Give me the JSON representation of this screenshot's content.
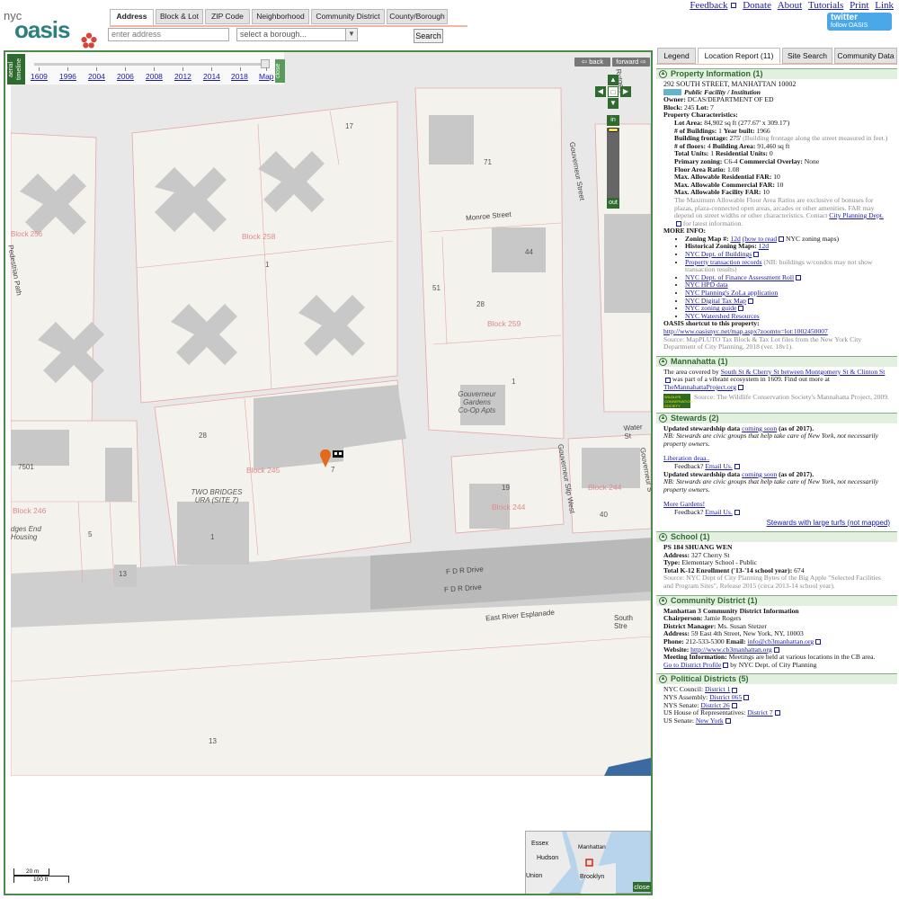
{
  "logo": {
    "top": "nyc",
    "main": "oasis"
  },
  "toplinks": [
    "Feedback",
    "Donate",
    "About",
    "Tutorials",
    "Print",
    "Link"
  ],
  "twitter": {
    "label": "twitter",
    "sub": "follow OASIS"
  },
  "search": {
    "tabs": [
      "Address",
      "Block & Lot",
      "ZIP Code",
      "Neighborhood",
      "Community District",
      "County/Borough"
    ],
    "address_placeholder": "enter address",
    "borough_placeholder": "select a borough...",
    "button": "Search"
  },
  "map": {
    "aerial_label": "aerial timeline",
    "close_label": "close",
    "years": [
      "1609",
      "1996",
      "2004",
      "2006",
      "2008",
      "2012",
      "2014",
      "2018",
      "Map"
    ],
    "back_label": "back",
    "forward_label": "forward",
    "zoom_in": "in",
    "zoom_out": "out",
    "overview_close": "close",
    "scale_m": "20 m",
    "scale_ft": "100 ft",
    "labels": {
      "block258": "Block 258",
      "block259": "Block 259",
      "block245": "Block 245",
      "block244a": "Block 244",
      "block244b": "Block 244",
      "block246": "Block 246",
      "block256": "Block 256",
      "lot17": "17",
      "lot71": "71",
      "lot44": "44",
      "lot51": "51",
      "lot28a": "28",
      "lot1a": "1",
      "lot1b": "1",
      "lot28b": "28",
      "lot7": "7",
      "lot19": "19",
      "lot40": "40",
      "lot5": "5",
      "lot1c": "1",
      "lot13a": "13",
      "lot13b": "13",
      "lot7501": "7501",
      "monroe": "Monroe Street",
      "water": "Water St",
      "gouverneur": "Gouverneur Street",
      "gouvslip": "Gouverneur Slip West",
      "gouvslip2": "Gouverneur S",
      "fdr1": "F D R Drive",
      "fdr2": "F D R Drive",
      "eastriver": "East River Esplanade",
      "southst": "South Stre",
      "ped": "Pedestrian Path",
      "twobridges1": "TWO BRIDGES",
      "twobridges2": "URA (SITE 7)",
      "gouvgardens1": "Gouverneur",
      "gouvgardens2": "Gardens",
      "gouvgardens3": "Co-Op Apts",
      "bridgesend1": "dges End",
      "bridgesend2": "Housing",
      "rutgers": "Rutgers"
    },
    "overview_labels": {
      "essex": "Essex",
      "hudson": "Hudson",
      "manhattan": "Manhattan",
      "brooklyn": "Brooklyn",
      "union": "Union"
    }
  },
  "panel": {
    "tabs": [
      "Legend",
      "Location Report (11)",
      "Site Search",
      "Community Data"
    ],
    "property": {
      "title": "Property Information (1)",
      "address": "292 SOUTH STREET, MANHATTAN 10002",
      "landuse": "Public Facility / Institution",
      "owner_label": "Owner:",
      "owner": "DCAS/DEPARTMENT OF ED",
      "block_label": "Block:",
      "block": "245",
      "lot_label": "Lot:",
      "lot": "7",
      "characteristics": "Property Characteristics:",
      "lot_area_label": "Lot Area:",
      "lot_area": "84,902 sq ft (277.67' x 309.17')",
      "buildings_label": "# of Buildings:",
      "buildings": "1",
      "year_label": "Year built:",
      "year": "1966",
      "frontage_label": "Building frontage:",
      "frontage": "275'",
      "frontage_note": "(Building frontage along the street measured in feet.)",
      "floors_label": "# of floors:",
      "floors": "4",
      "bldg_area_label": "Building Area:",
      "bldg_area": "91,460 sq ft",
      "units_label": "Total Units:",
      "units": "1",
      "res_units_label": "Residential Units:",
      "res_units": "0",
      "zoning_label": "Primary zoning:",
      "zoning": "C6-4",
      "overlay_label": "Commercial Overlay:",
      "overlay": "None",
      "far_label": "Floor Area Ratio:",
      "far": "1.08",
      "maxres_label": "Max. Allowable Residential FAR:",
      "maxres": "10",
      "maxcom_label": "Max. Allowable Commercial FAR:",
      "maxcom": "10",
      "maxfac_label": "Max. Allowable Facility FAR:",
      "maxfac": "10",
      "far_note": "The Maximum Allowable Floor Area Ratios are exclusive of bonuses for plazas, plaza-connected open areas, arcades or other amenities. FAR may depend on street widths or other characteristics. Contact",
      "cpd_link": "City Planning Dept.",
      "cpd_after": "for latest information.",
      "more_info": "MORE INFO:",
      "zoning_map_label": "Zoning Map #:",
      "zoning_map": "12d",
      "how_to_read": "(how to read",
      "nyc_zoning_maps": "NYC zoning maps)",
      "hist_label": "Historical Zoning Maps:",
      "hist": "12d",
      "dob": "NYC Dept. of Buildings",
      "ptr": "Property transaction records",
      "ptr_note": "(NB: buildings w/condos may not show transaction results)",
      "dof": "NYC Dept. of Finance Assessment Roll",
      "hpd": "NYC HPD data",
      "zola": "NYC Planning's ZoLa application",
      "dtm": "NYC Digital Tax Map",
      "zguide": "NYC zoning guide",
      "watershed": "NYC Watershed Resources",
      "shortcut_label": "OASIS shortcut to this property:",
      "shortcut": "http://www.oasisnyc.net/map.aspx?zoomto=lot:1002450007",
      "source": "Source: MapPLUTO Tax Block & Tax Lot files from the New York City Department of City Planning, 2018 (ver. 18v1)."
    },
    "mannahatta": {
      "title": "Mannahatta (1)",
      "text1": "The area covered by",
      "link1": "South St & Cherry St between Montgomery St & Clinton St",
      "text2": "was part of a vibrant ecosystem in 1609. Find out more at",
      "link2": "TheMannahattaProject.org",
      "logo": "WILDLIFE CONSERVATION SOCIETY",
      "source": "Source: The Wildlife Conservation Society's Mannahatta Project, 2009."
    },
    "stewards": {
      "title": "Stewards (2)",
      "updated": "Updated stewardship data",
      "soon": "coming soon",
      "asof": "(as of 2017).",
      "nb": "NB: Stewards are civic groups that help take care of New York, not necessarily property owners.",
      "group1": "Liberation deaa..",
      "feedback": "Feedback?",
      "email": "Email Us.",
      "group2": "More Gardens!",
      "large_turfs": "Stewards with large turfs (not mapped)"
    },
    "school": {
      "title": "School (1)",
      "name": "PS 184 SHUANG WEN",
      "address_label": "Address:",
      "address": "327 Cherry St",
      "type_label": "Type:",
      "type": "Elementary School - Public",
      "enroll_label": "Total K-12 Enrollment ('13-'14 school year):",
      "enroll": "674",
      "source": "Source: NYC Dept of City Planning Bytes of the Big Apple \"Selected Facilities and Program Sites\", Release 2015 (circa 2013-14 school year)."
    },
    "cd": {
      "title": "Community District (1)",
      "name": "Manhattan 3 Community District Information",
      "chair_label": "Chairperson:",
      "chair": "Jamie Rogers",
      "dm_label": "District Manager:",
      "dm": "Ms. Susan Stetzer",
      "address_label": "Address:",
      "address": "59 East 4th Street, New York, NY, 10003",
      "phone_label": "Phone:",
      "phone": "212-533-5300",
      "email_label": "Email:",
      "email": "info@cb3manhattan.org",
      "web_label": "Website:",
      "web": "http://www.cb3manhattan.org",
      "meeting_label": "Meeting Information:",
      "meeting": "Meetings are held at various locations in the CB area.",
      "profile": "Go to District Profile",
      "profile_after": "by NYC Dept. of City Planning"
    },
    "political": {
      "title": "Political Districts (5)",
      "council_label": "NYC Council:",
      "council": "District 1",
      "assembly_label": "NYS Assembly:",
      "assembly": "District 065",
      "senate_label": "NYS Senate:",
      "senate": "District 26",
      "house_label": "US House of Representatives:",
      "house": "District 7",
      "ussenate_label": "US Senate:",
      "ussenate": "New York"
    }
  },
  "colors": {
    "accent": "#2f6b2f",
    "link": "#1a1aa6",
    "block_label": "#e08a8a",
    "highlight": "#f2b6a4"
  }
}
